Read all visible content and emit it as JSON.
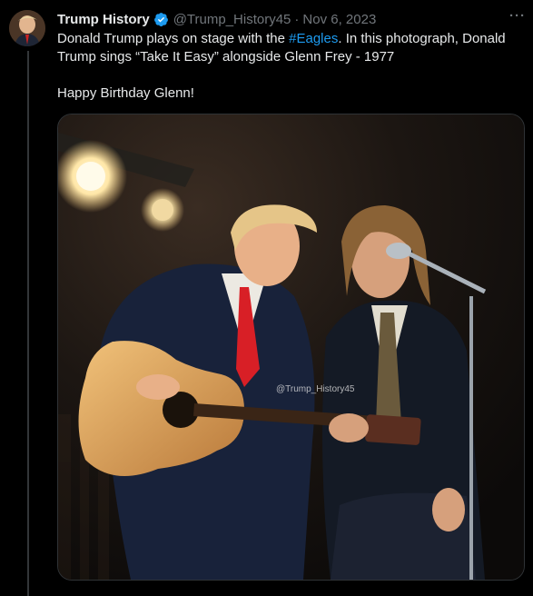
{
  "tweet": {
    "author_name": "Trump History",
    "handle": "@Trump_History45",
    "separator": "·",
    "date": "Nov 6, 2023",
    "more_label": "···",
    "text_before_hashtag": "Donald Trump plays on stage with the ",
    "hashtag": "#Eagles",
    "text_after_hashtag": ". In this photograph, Donald Trump sings “Take It Easy” alongside Glenn Frey - 1977",
    "second_paragraph": "Happy Birthday Glenn!",
    "image_watermark": "@Trump_History45"
  },
  "colors": {
    "background": "#000000",
    "text": "#e7e9ea",
    "secondary": "#71767b",
    "accent": "#1d9bf0"
  },
  "icons": {
    "verified": "verified-badge-icon",
    "more": "more-options-icon"
  }
}
